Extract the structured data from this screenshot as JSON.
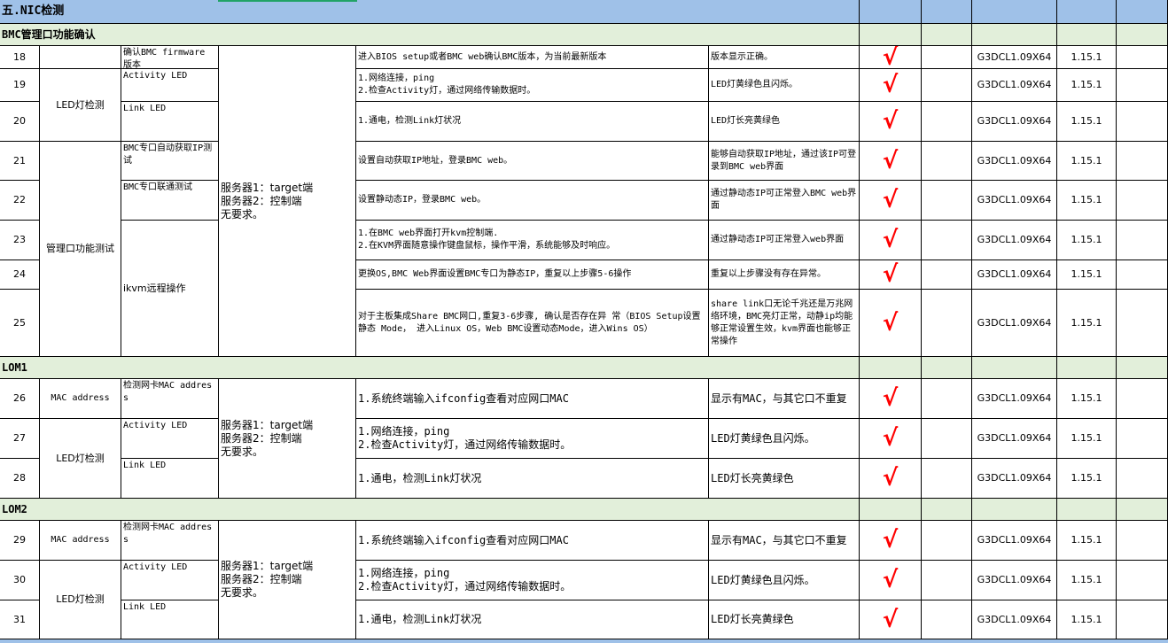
{
  "section_title": "五.NIC检测",
  "subsections": {
    "bmc": "BMC管理口功能确认",
    "lom1": "LOM1",
    "lom2": "LOM2"
  },
  "check_mark": "√",
  "check_color": "#ff0000",
  "header_color": "#9fc1e8",
  "subheader_color": "#e2efda",
  "bmc_rows": [
    {
      "no": "18",
      "item": "确认BMC firmware 版本",
      "steps": "进入BIOS setup或者BMC web确认BMC版本，为当前最新版本",
      "expected": "版本显示正确。",
      "fw": "G3DCL1.09X64",
      "ver": "1.15.1"
    },
    {
      "no": "19",
      "item": "Activity LED",
      "steps": "1.网络连接，ping\n2.检查Activity灯，通过网络传输数据时。",
      "expected": "LED灯黄绿色且闪烁。",
      "fw": "G3DCL1.09X64",
      "ver": "1.15.1"
    },
    {
      "no": "20",
      "item": "Link LED",
      "steps": "1.通电，检测Link灯状况",
      "expected": "LED灯长亮黄绿色",
      "fw": "G3DCL1.09X64",
      "ver": "1.15.1"
    },
    {
      "no": "21",
      "item": "BMC专口自动获取IP测试",
      "steps": "设置自动获取IP地址，登录BMC web。",
      "expected": "能够自动获取IP地址，通过该IP可登录到BMC web界面",
      "fw": "G3DCL1.09X64",
      "ver": "1.15.1"
    },
    {
      "no": "22",
      "item": "BMC专口联通测试",
      "steps": "设置静动态IP，登录BMC web。",
      "expected": "通过静动态IP可正常登入BMC web界面",
      "fw": "G3DCL1.09X64",
      "ver": "1.15.1"
    },
    {
      "no": "23",
      "item": "",
      "steps": "1.在BMC web界面打开kvm控制端.\n2.在KVM界面随意操作键盘鼠标，操作平滑，系统能够及时响应。",
      "expected": "通过静动态IP可正常登入web界面",
      "fw": "G3DCL1.09X64",
      "ver": "1.15.1"
    },
    {
      "no": "24",
      "item": "",
      "steps": "更换OS,BMC Web界面设置BMC专口为静态IP，重复以上步骤5-6操作",
      "expected": "重复以上步骤没有存在异常。",
      "fw": "G3DCL1.09X64",
      "ver": "1.15.1"
    },
    {
      "no": "25",
      "item": "",
      "steps": "对于主板集成Share BMC网口,重复3-6步骤, 确认是否存在异 常（BIOS Setup设置静态 Mode， 进入Linux OS，Web BMC设置动态Mode，进入Wins OS）",
      "expected": "share link口无论千兆还是万兆网络环境，BMC亮灯正常，动静ip均能够正常设置生效，kvm界面也能够正常操作",
      "fw": "G3DCL1.09X64",
      "ver": "1.15.1"
    }
  ],
  "bmc_groups": {
    "led": "LED灯检测",
    "mgmt": "管理口功能测试",
    "ikvm": "ikvm远程操作",
    "env": "服务器1：target端\n服务器2：控制端\n无要求。"
  },
  "lom1_rows": [
    {
      "no": "26",
      "item": "检测网卡MAC address",
      "steps": "1.系统终端输入ifconfig查看对应网口MAC",
      "expected": "显示有MAC，与其它口不重复",
      "fw": "G3DCL1.09X64",
      "ver": "1.15.1"
    },
    {
      "no": "27",
      "item": "Activity LED",
      "steps": "1.网络连接，ping\n2.检查Activity灯，通过网络传输数据时。",
      "expected": "LED灯黄绿色且闪烁。",
      "fw": "G3DCL1.09X64",
      "ver": "1.15.1"
    },
    {
      "no": "28",
      "item": "Link LED",
      "steps": "1.通电，检测Link灯状况",
      "expected": "LED灯长亮黄绿色",
      "fw": "G3DCL1.09X64",
      "ver": "1.15.1"
    }
  ],
  "lom1_groups": {
    "mac": "MAC address",
    "led": "LED灯检测",
    "env": "服务器1：target端\n服务器2：控制端\n无要求。"
  },
  "lom2_rows": [
    {
      "no": "29",
      "item": "检测网卡MAC address",
      "steps": "1.系统终端输入ifconfig查看对应网口MAC",
      "expected": "显示有MAC，与其它口不重复",
      "fw": "G3DCL1.09X64",
      "ver": "1.15.1"
    },
    {
      "no": "30",
      "item": "Activity LED",
      "steps": "1.网络连接，ping\n2.检查Activity灯，通过网络传输数据时。",
      "expected": "LED灯黄绿色且闪烁。",
      "fw": "G3DCL1.09X64",
      "ver": "1.15.1"
    },
    {
      "no": "31",
      "item": "Link LED",
      "steps": "1.通电，检测Link灯状况",
      "expected": "LED灯长亮黄绿色",
      "fw": "G3DCL1.09X64",
      "ver": "1.15.1"
    }
  ],
  "lom2_groups": {
    "mac": "MAC address",
    "led": "LED灯检测",
    "env": "服务器1：target端\n服务器2：控制端\n无要求。"
  }
}
